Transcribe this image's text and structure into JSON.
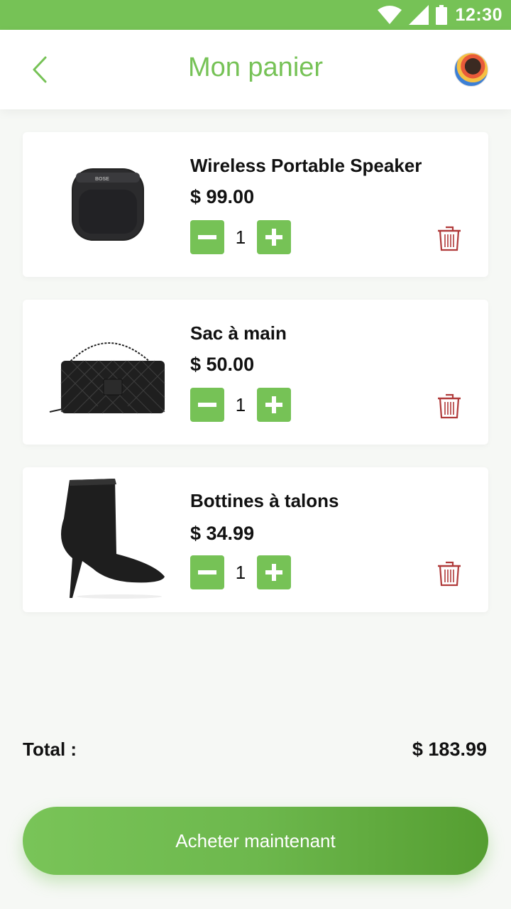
{
  "status_bar": {
    "time": "12:30"
  },
  "header": {
    "title": "Mon panier"
  },
  "cart": {
    "items": [
      {
        "name": "Wireless Portable Speaker",
        "price": "$ 99.00",
        "quantity": "1",
        "image": "speaker"
      },
      {
        "name": "Sac à main",
        "price": "$ 50.00",
        "quantity": "1",
        "image": "handbag"
      },
      {
        "name": "Bottines à talons",
        "price": "$ 34.99",
        "quantity": "1",
        "image": "heeled-boot"
      }
    ]
  },
  "summary": {
    "total_label": "Total :",
    "total_value": "$ 183.99"
  },
  "checkout": {
    "button_label": "Acheter maintenant"
  },
  "colors": {
    "accent": "#76c256",
    "delete": "#b03a3a",
    "background": "#f6f8f5"
  }
}
